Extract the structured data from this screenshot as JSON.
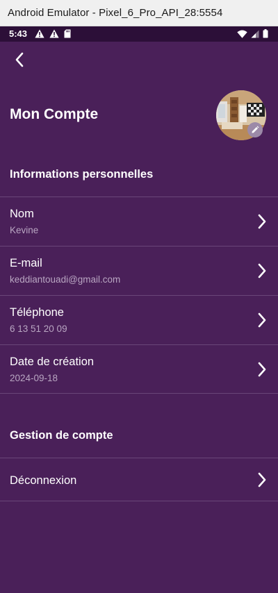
{
  "window": {
    "title": "Android Emulator - Pixel_6_Pro_API_28:5554"
  },
  "status_bar": {
    "time": "5:43",
    "left_icons": [
      "warning-icon",
      "warning-icon",
      "sd-card-icon"
    ],
    "right_icons": [
      "wifi-icon",
      "signal-icon",
      "battery-icon"
    ]
  },
  "header": {
    "back_icon": "chevron-left-icon",
    "title": "Mon Compte",
    "avatar_edit_icon": "pencil-icon"
  },
  "sections": {
    "personal": {
      "header": "Informations personnelles",
      "rows": [
        {
          "label": "Nom",
          "value": "Kevine"
        },
        {
          "label": "E-mail",
          "value": "keddiantouadi@gmail.com"
        },
        {
          "label": "Téléphone",
          "value": "6 13 51 20 09"
        },
        {
          "label": "Date de création",
          "value": "2024-09-18"
        }
      ]
    },
    "account": {
      "header": "Gestion de compte",
      "rows": [
        {
          "label": "Déconnexion"
        }
      ]
    }
  },
  "colors": {
    "background": "#4a2059",
    "status_bar": "#2c0f38",
    "divider": "#6a4679",
    "secondary_text": "#b9a6c2",
    "edit_badge": "#9c8aa8"
  }
}
